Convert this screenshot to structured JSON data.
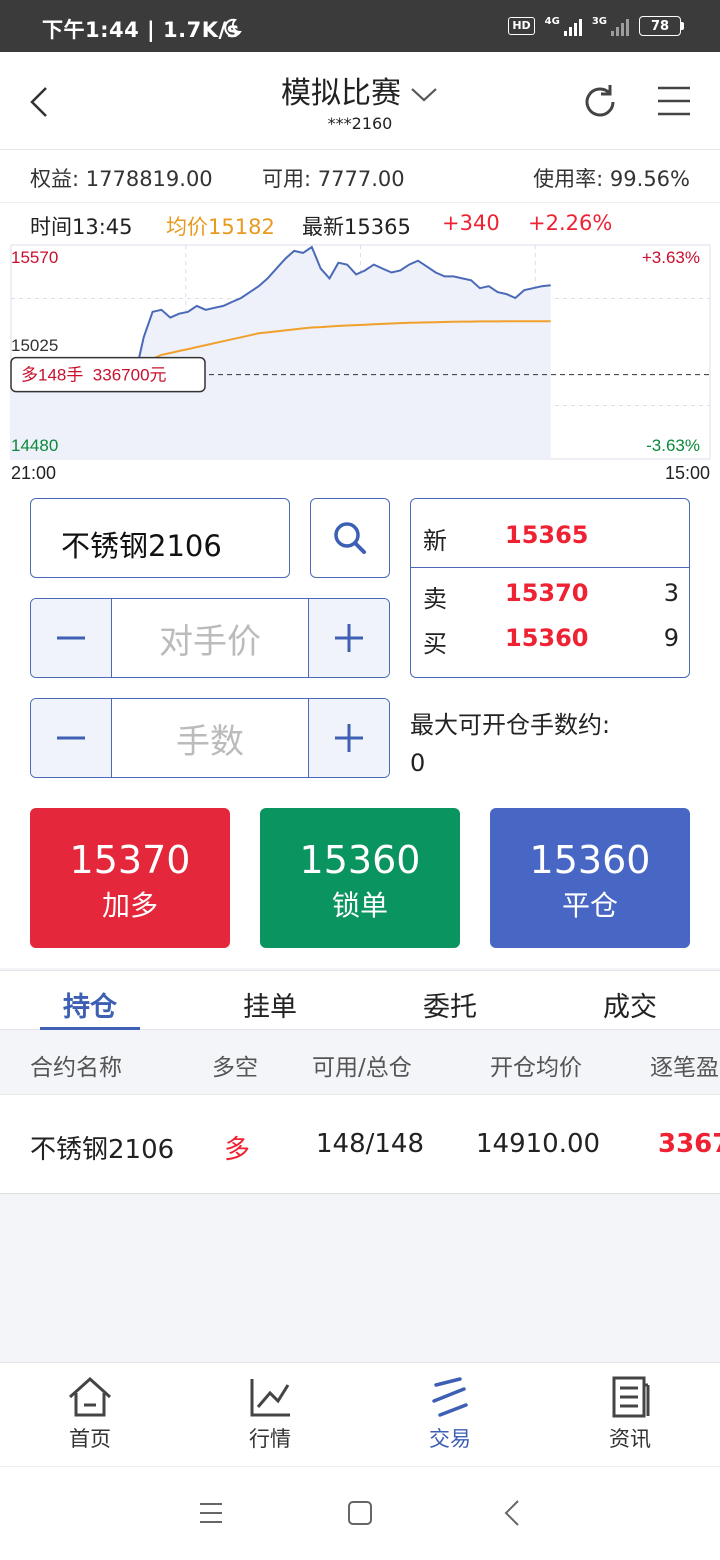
{
  "status_bar": {
    "time_speed": "下午1:44 | 1.7K/s",
    "hd": "HD",
    "net1": "4G",
    "net2": "3G",
    "battery": "78"
  },
  "header": {
    "title": "模拟比赛",
    "account": "***2160"
  },
  "account_summary": {
    "equity": "权益: 1778819.00",
    "available": "可用: 7777.00",
    "usage": "使用率: 99.56%"
  },
  "quote_bar": {
    "time": "时间13:45",
    "avg": "均价15182",
    "latest": "最新15365",
    "change": "+340",
    "change_pct": "+2.26%"
  },
  "chart_data": {
    "type": "line",
    "y_top_label": "15570",
    "y_mid_label": "15025",
    "y_bottom_label": "14480",
    "pct_top": "+3.63%",
    "pct_bottom": "-3.63%",
    "x_start": "21:00",
    "x_end": "15:00",
    "ylim": [
      14480,
      15570
    ],
    "position_tag": "多148手  336700元",
    "position_price": 14910,
    "series": [
      {
        "values": [
          14900,
          14905,
          14905,
          14898,
          14902,
          14905,
          14903,
          14906,
          14904,
          14905,
          14903,
          14904,
          14902,
          14905,
          14900,
          15100,
          15230,
          15240,
          15200,
          15220,
          15230,
          15260,
          15240,
          15250,
          15260,
          15280,
          15300,
          15330,
          15360,
          15400,
          15450,
          15500,
          15540,
          15530,
          15560,
          15450,
          15400,
          15480,
          15470,
          15420,
          15440,
          15470,
          15450,
          15430,
          15440,
          15470,
          15490,
          15460,
          15430,
          15410,
          15410,
          15400,
          15390,
          15350,
          15360,
          15330,
          15320,
          15300,
          15340,
          15350,
          15360,
          15365
        ]
      },
      {
        "values": [
          14900,
          14902,
          14902,
          14902,
          14902,
          14902,
          14902,
          14902,
          14902,
          14902,
          14902,
          14902,
          14902,
          14902,
          14902,
          14950,
          14990,
          15010,
          15020,
          15030,
          15040,
          15050,
          15060,
          15070,
          15080,
          15090,
          15100,
          15110,
          15120,
          15125,
          15130,
          15135,
          15140,
          15145,
          15150,
          15152,
          15155,
          15158,
          15160,
          15162,
          15164,
          15166,
          15168,
          15170,
          15172,
          15174,
          15175,
          15176,
          15177,
          15178,
          15179,
          15180,
          15180,
          15181,
          15181,
          15181,
          15182,
          15182,
          15182,
          15182,
          15182,
          15182
        ]
      }
    ],
    "total_points": 80,
    "colors": {
      "price": "#4a6ab7",
      "avg": "#f0a12b",
      "fill": "#eef0fa"
    }
  },
  "order": {
    "contract": "不锈钢2106",
    "price_placeholder": "对手价",
    "qty_placeholder": "手数",
    "quote": {
      "new_label": "新",
      "new_value": "15365",
      "sell_label": "卖",
      "sell_value": "15370",
      "sell_qty": "3",
      "buy_label": "买",
      "buy_value": "15360",
      "buy_qty": "9"
    },
    "max_open_label": "最大可开仓手数约:",
    "max_open_value": "0"
  },
  "buttons": {
    "long": {
      "price": "15370",
      "label": "加多",
      "color": "#e4273b"
    },
    "lock": {
      "price": "15360",
      "label": "锁单",
      "color": "#0a9460"
    },
    "close": {
      "price": "15360",
      "label": "平仓",
      "color": "#4866c4"
    }
  },
  "tabs": [
    "持仓",
    "挂单",
    "委托",
    "成交"
  ],
  "positions": {
    "headers": [
      "合约名称",
      "多空",
      "可用/总仓",
      "开仓均价",
      "逐笔盈"
    ],
    "rows": [
      {
        "name": "不锈钢2106",
        "side": "多",
        "qty": "148/148",
        "avg_price": "14910.00",
        "pnl": "3367"
      }
    ]
  },
  "bottom_nav": [
    "首页",
    "行情",
    "交易",
    "资讯"
  ]
}
